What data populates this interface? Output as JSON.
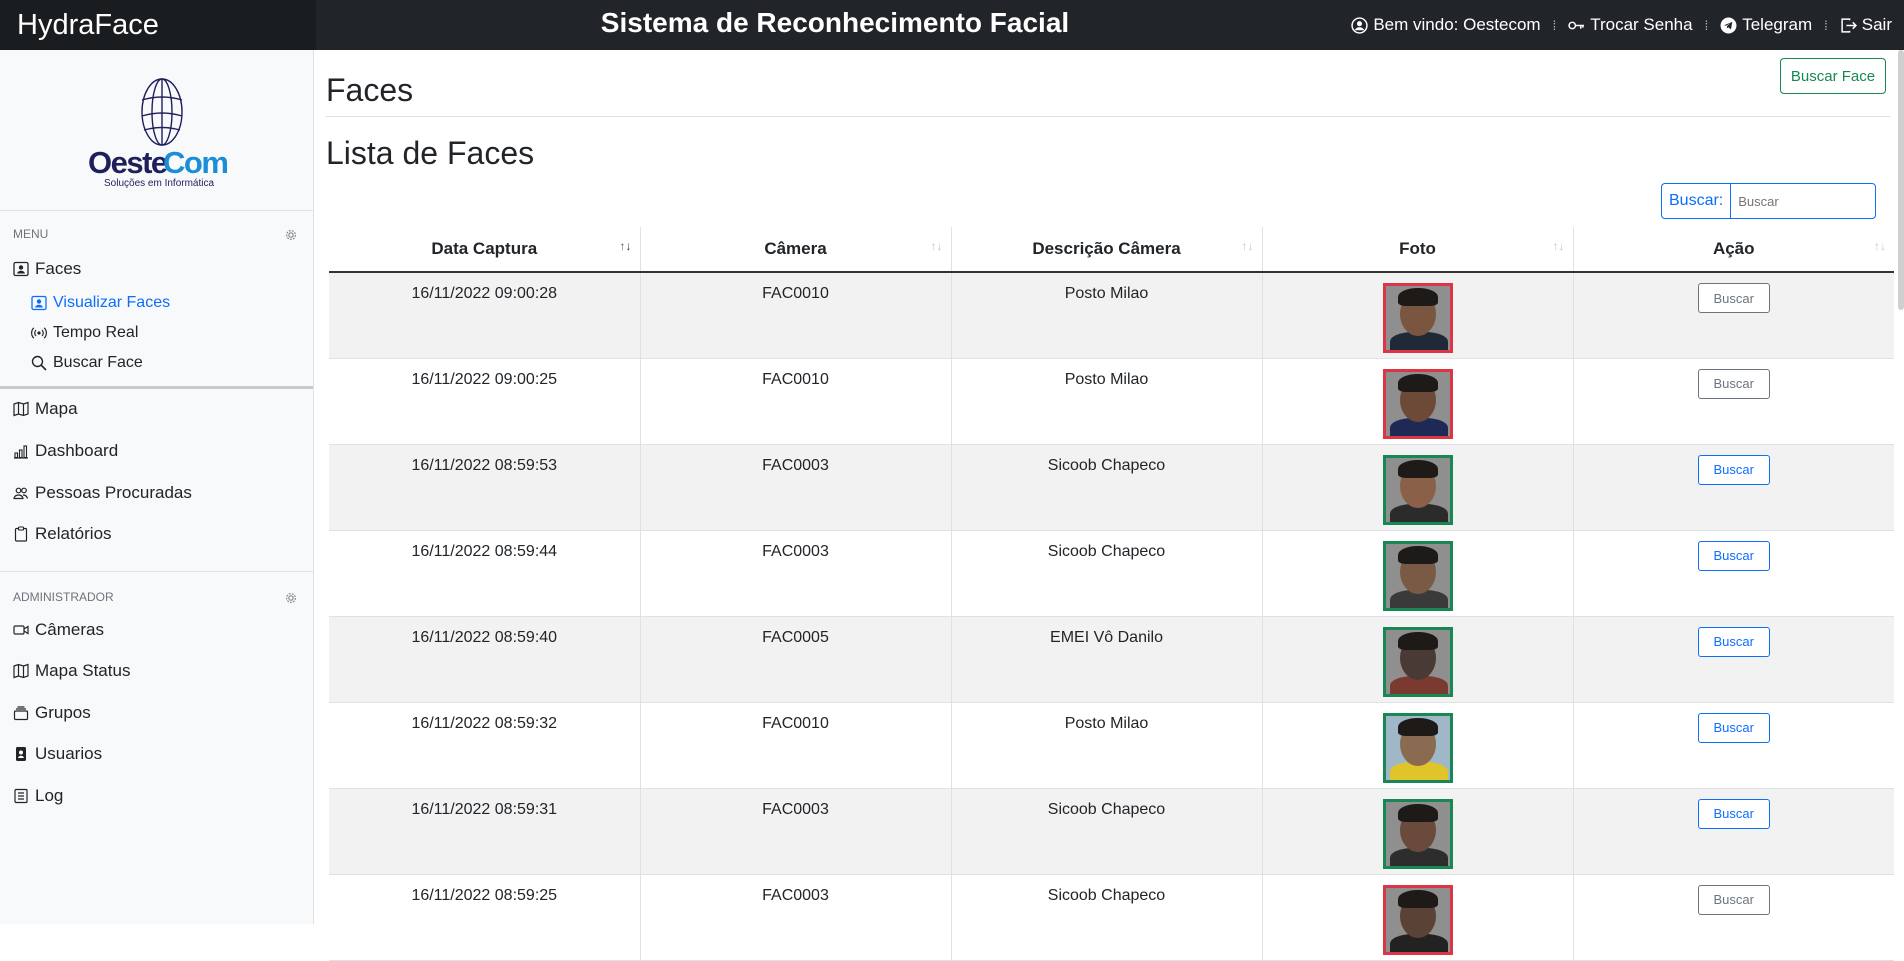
{
  "app": {
    "brand": "HydraFace",
    "title": "Sistema de Reconhecimento Facial"
  },
  "topnav": {
    "welcome": "Bem vindo: Oestecom",
    "change_password": "Trocar Senha",
    "telegram": "Telegram",
    "logout": "Sair"
  },
  "logo": {
    "name_part1": "Oeste",
    "name_part2": "Com",
    "tagline": "Soluções em Informática"
  },
  "sidebar": {
    "menu_header": "MENU",
    "faces": "Faces",
    "faces_sub": [
      "Visualizar Faces",
      "Tempo Real",
      "Buscar Face"
    ],
    "items": [
      "Mapa",
      "Dashboard",
      "Pessoas Procuradas",
      "Relatórios"
    ],
    "admin_header": "ADMINISTRADOR",
    "admin_items": [
      "Câmeras",
      "Mapa Status",
      "Grupos",
      "Usuarios",
      "Log"
    ]
  },
  "main": {
    "page_title": "Faces",
    "buscar_face_button": "Buscar Face",
    "list_title": "Lista de Faces",
    "search_label": "Buscar:",
    "search_placeholder": "Buscar"
  },
  "table": {
    "headers": [
      "Data Captura",
      "Câmera",
      "Descrição Câmera",
      "Foto",
      "Ação"
    ],
    "rows": [
      {
        "date": "16/11/2022 09:00:28",
        "camera": "FAC0010",
        "desc": "Posto Milao",
        "border": "red",
        "action": "Buscar",
        "enabled": false
      },
      {
        "date": "16/11/2022 09:00:25",
        "camera": "FAC0010",
        "desc": "Posto Milao",
        "border": "red",
        "action": "Buscar",
        "enabled": false
      },
      {
        "date": "16/11/2022 08:59:53",
        "camera": "FAC0003",
        "desc": "Sicoob Chapeco",
        "border": "green",
        "action": "Buscar",
        "enabled": true
      },
      {
        "date": "16/11/2022 08:59:44",
        "camera": "FAC0003",
        "desc": "Sicoob Chapeco",
        "border": "green",
        "action": "Buscar",
        "enabled": true
      },
      {
        "date": "16/11/2022 08:59:40",
        "camera": "FAC0005",
        "desc": "EMEI Vô Danilo",
        "border": "green",
        "action": "Buscar",
        "enabled": true
      },
      {
        "date": "16/11/2022 08:59:32",
        "camera": "FAC0010",
        "desc": "Posto Milao",
        "border": "green",
        "action": "Buscar",
        "enabled": true
      },
      {
        "date": "16/11/2022 08:59:31",
        "camera": "FAC0003",
        "desc": "Sicoob Chapeco",
        "border": "green",
        "action": "Buscar",
        "enabled": true
      },
      {
        "date": "16/11/2022 08:59:25",
        "camera": "FAC0003",
        "desc": "Sicoob Chapeco",
        "border": "red",
        "action": "Buscar",
        "enabled": false
      }
    ]
  }
}
